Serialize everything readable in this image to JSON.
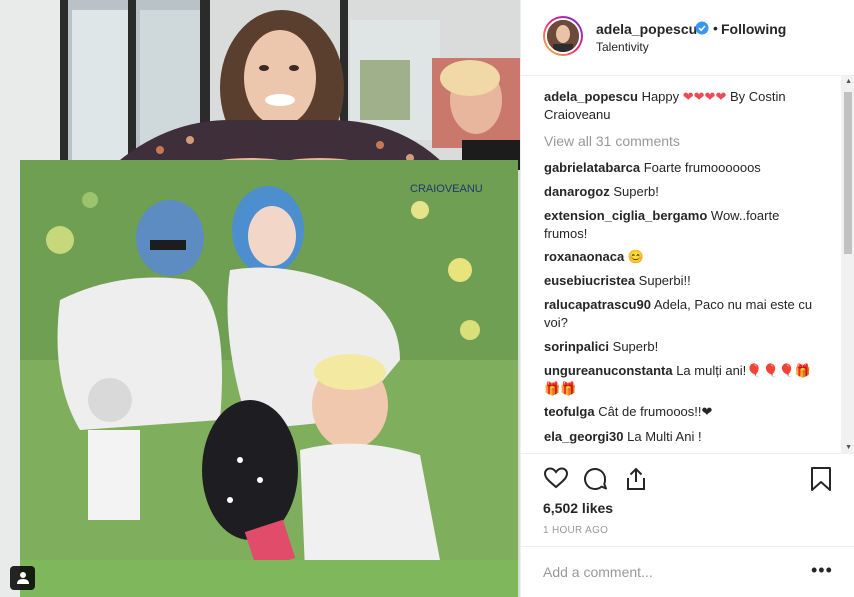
{
  "post": {
    "username": "adela_popescu",
    "follow_status": "Following",
    "location": "Talentivity",
    "dot": "•",
    "caption": {
      "user": "adela_popescu",
      "text_before": "Happy",
      "hearts": "❤❤❤❤",
      "text_after": "By Costin Craioveanu"
    },
    "view_all": "View all 31 comments",
    "comments": [
      {
        "user": "gabrielatabarca",
        "text": "Foarte frumoooooos"
      },
      {
        "user": "danarogoz",
        "text": "Superb!"
      },
      {
        "user": "extension_ciglia_bergamo",
        "text": "Wow..foarte frumos!"
      },
      {
        "user": "roxanaonaca",
        "text": "😊"
      },
      {
        "user": "eusebiucristea",
        "text": "Superbi!!"
      },
      {
        "user": "ralucapatrascu90",
        "text": "Adela, Paco nu mai este cu voi?"
      },
      {
        "user": "sorinpalici",
        "text": "Superb!"
      },
      {
        "user": "ungureanuconstanta",
        "text": "La mulți ani!🎈🎈🎈🎁🎁🎁"
      },
      {
        "user": "teofulga",
        "text": "Cât de frumooos!!❤"
      },
      {
        "user": "ela_georgi30",
        "text": "La Multi Ani !"
      }
    ],
    "likes": "6,502 likes",
    "time": "1 HOUR AGO",
    "add_comment_placeholder": "Add a comment...",
    "more": "•••",
    "painting_signature": "CRAIOVEANU"
  },
  "icons": {
    "like": "heart-outline-icon",
    "comment": "comment-icon",
    "share": "share-icon",
    "save": "bookmark-icon",
    "verified": "verified-badge-icon",
    "user_tag": "person-icon"
  },
  "colors": {
    "verified": "#3897f0",
    "muted": "#999999",
    "text": "#262626",
    "border": "#efefef",
    "heart": "#ed4956"
  }
}
